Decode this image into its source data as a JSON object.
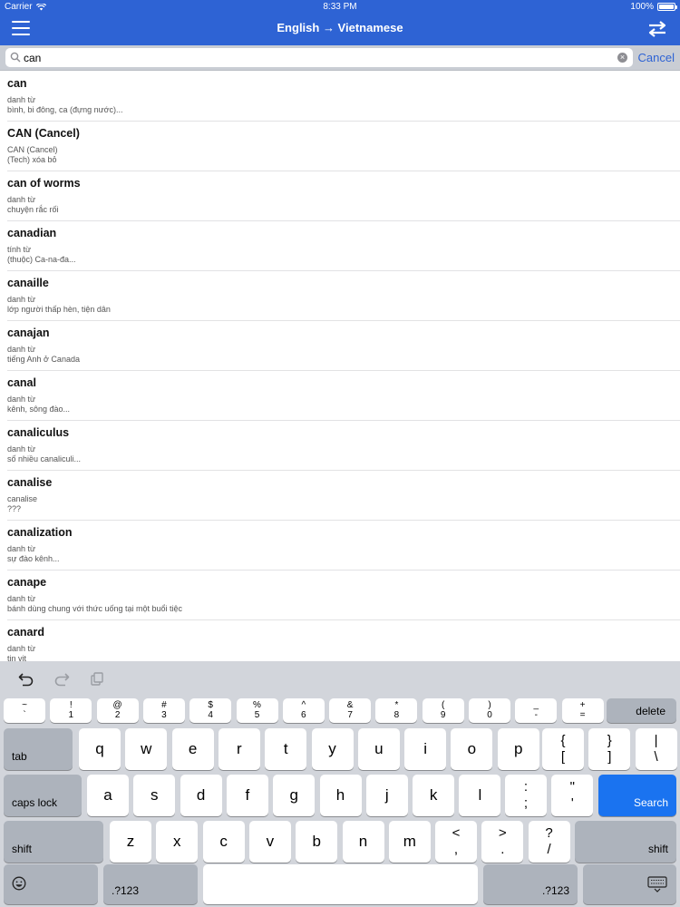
{
  "status": {
    "carrier": "Carrier",
    "time": "8:33 PM",
    "battery": "100%",
    "battery_level": 1.0
  },
  "nav": {
    "title": "English → Vietnamese",
    "menu_icon": "hamburger-icon",
    "swap_icon": "swap-arrows-icon"
  },
  "search": {
    "value": "can",
    "cancel_label": "Cancel"
  },
  "results": [
    {
      "word": "can",
      "pos": "danh từ",
      "meaning": "bình, bi đông, ca (đựng nước)..."
    },
    {
      "word": "CAN (Cancel)",
      "pos": "CAN (Cancel)",
      "meaning": "(Tech) xóa bỏ"
    },
    {
      "word": "can of worms",
      "pos": "danh từ",
      "meaning": "chuyện rắc rối"
    },
    {
      "word": "canadian",
      "pos": "tính từ",
      "meaning": "(thuộc) Ca-na-đa..."
    },
    {
      "word": "canaille",
      "pos": "danh từ",
      "meaning": "lớp người thấp hèn, tiện dân"
    },
    {
      "word": "canajan",
      "pos": "danh từ",
      "meaning": "tiếng Anh ở Canada"
    },
    {
      "word": "canal",
      "pos": "danh từ",
      "meaning": "kênh, sông đào..."
    },
    {
      "word": "canaliculus",
      "pos": "danh từ",
      "meaning": "số nhiều canaliculi..."
    },
    {
      "word": "canalise",
      "pos": "canalise",
      "meaning": "???"
    },
    {
      "word": "canalization",
      "pos": "danh từ",
      "meaning": "sự đào kênh..."
    },
    {
      "word": "canape",
      "pos": "danh từ",
      "meaning": "bánh dùng chung với thức uống tại một buổi tiệc"
    },
    {
      "word": "canard",
      "pos": "danh từ",
      "meaning": "tin vịt"
    }
  ],
  "keyboard": {
    "number_row": [
      {
        "top": "~",
        "bot": "`"
      },
      {
        "top": "!",
        "bot": "1"
      },
      {
        "top": "@",
        "bot": "2"
      },
      {
        "top": "#",
        "bot": "3"
      },
      {
        "top": "$",
        "bot": "4"
      },
      {
        "top": "%",
        "bot": "5"
      },
      {
        "top": "^",
        "bot": "6"
      },
      {
        "top": "&",
        "bot": "7"
      },
      {
        "top": "*",
        "bot": "8"
      },
      {
        "top": "(",
        "bot": "9"
      },
      {
        "top": ")",
        "bot": "0"
      },
      {
        "top": "_",
        "bot": "-"
      },
      {
        "top": "+",
        "bot": "="
      }
    ],
    "row1_letters": [
      "q",
      "w",
      "e",
      "r",
      "t",
      "y",
      "u",
      "i",
      "o",
      "p"
    ],
    "row1_symbols": [
      {
        "top": "{",
        "bot": "["
      },
      {
        "top": "}",
        "bot": "]"
      },
      {
        "top": "|",
        "bot": "\\"
      }
    ],
    "row2_letters": [
      "a",
      "s",
      "d",
      "f",
      "g",
      "h",
      "j",
      "k",
      "l"
    ],
    "row2_symbols": [
      {
        "top": ":",
        "bot": ";"
      },
      {
        "top": "\"",
        "bot": "'"
      }
    ],
    "row3_letters": [
      "z",
      "x",
      "c",
      "v",
      "b",
      "n",
      "m"
    ],
    "row3_symbols": [
      {
        "top": "<",
        "bot": ","
      },
      {
        "top": ">",
        "bot": "."
      },
      {
        "top": "?",
        "bot": "/"
      }
    ],
    "delete_label": "delete",
    "tab_label": "tab",
    "caps_label": "caps lock",
    "search_label": "Search",
    "shift_label": "shift",
    "numbers_label": ".?123",
    "emoji_icon": "emoji-icon",
    "dismiss_icon": "keyboard-dismiss-icon",
    "search_key_color": "#1a73f0"
  }
}
